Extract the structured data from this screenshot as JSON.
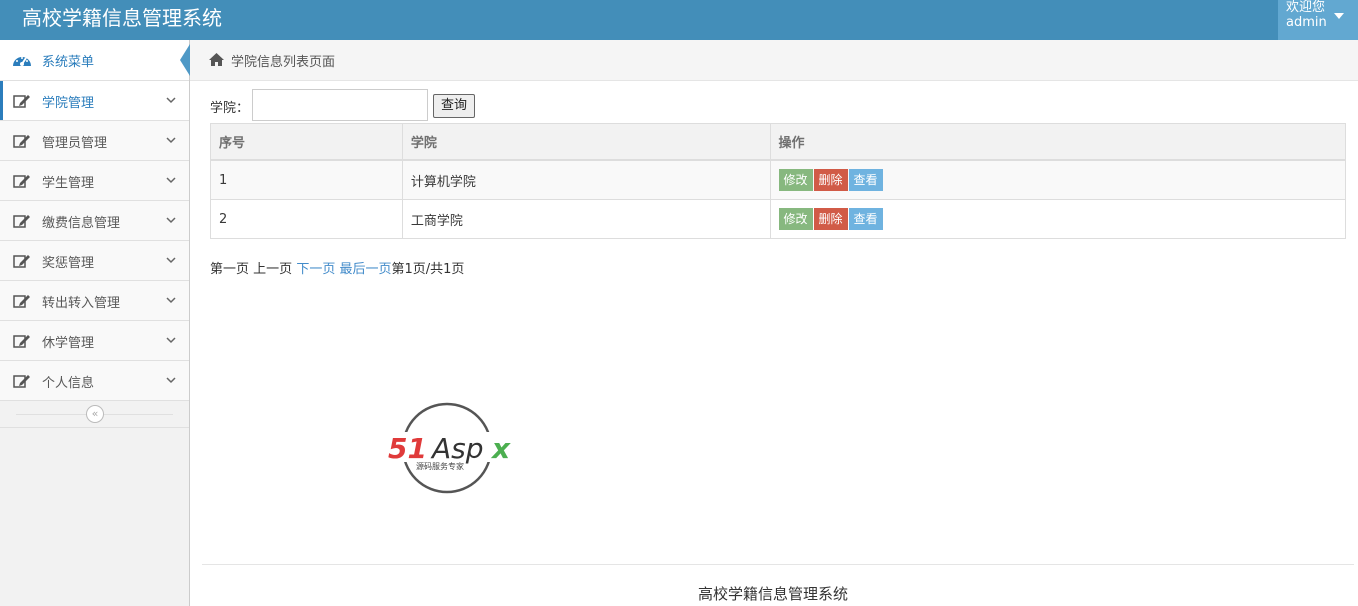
{
  "app": {
    "title": "高校学籍信息管理系统"
  },
  "user": {
    "welcome": "欢迎您",
    "name": "admin"
  },
  "sidebar": {
    "header": "系统菜单",
    "items": [
      {
        "label": "学院管理",
        "active": true
      },
      {
        "label": "管理员管理"
      },
      {
        "label": "学生管理"
      },
      {
        "label": "缴费信息管理"
      },
      {
        "label": "奖惩管理"
      },
      {
        "label": "转出转入管理"
      },
      {
        "label": "休学管理"
      },
      {
        "label": "个人信息"
      }
    ]
  },
  "breadcrumb": {
    "current": "学院信息列表页面"
  },
  "search": {
    "label": "学院：",
    "value": "",
    "button": "查询"
  },
  "table": {
    "headers": [
      "序号",
      "学院",
      "操作"
    ],
    "rows": [
      {
        "no": "1",
        "college": "计算机学院"
      },
      {
        "no": "2",
        "college": "工商学院"
      }
    ],
    "actions": {
      "edit": "修改",
      "delete": "删除",
      "view": "查看"
    }
  },
  "pager": {
    "first": "第一页",
    "prev": "上一页",
    "next": "下一页",
    "last": "最后一页",
    "status": "第1页/共1页"
  },
  "logo": {
    "text": "51Aspx",
    "tagline": "源码服务专家"
  },
  "footer": {
    "text": "高校学籍信息管理系统"
  }
}
